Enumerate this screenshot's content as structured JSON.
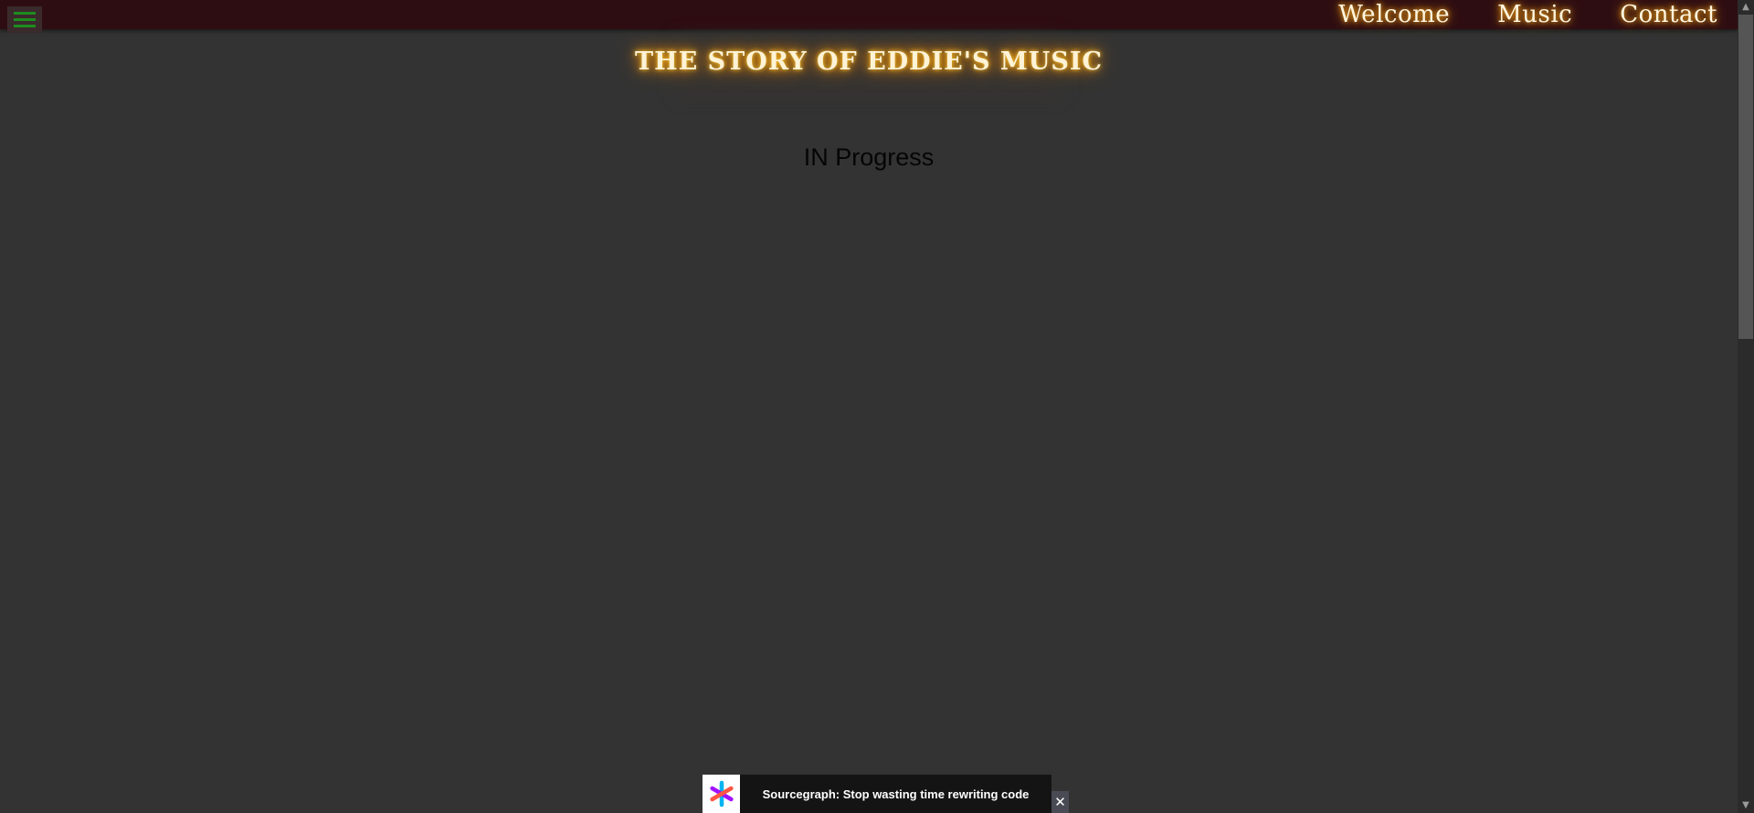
{
  "nav": {
    "menu_icon": "hamburger-menu-icon",
    "links": [
      {
        "label": "Welcome"
      },
      {
        "label": "Music"
      },
      {
        "label": "Contact"
      }
    ]
  },
  "header": {
    "title": "THE STORY OF EDDIE'S MUSIC"
  },
  "main": {
    "status": "IN Progress"
  },
  "ad": {
    "text": "Sourcegraph: Stop wasting time rewriting code",
    "logo_icon": "sourcegraph-logo-icon",
    "close_label": "✕"
  },
  "colors": {
    "background": "#333333",
    "topbar": "#2e0d12",
    "menu_lines": "#1e8c1e",
    "glow": "#ff9900"
  }
}
